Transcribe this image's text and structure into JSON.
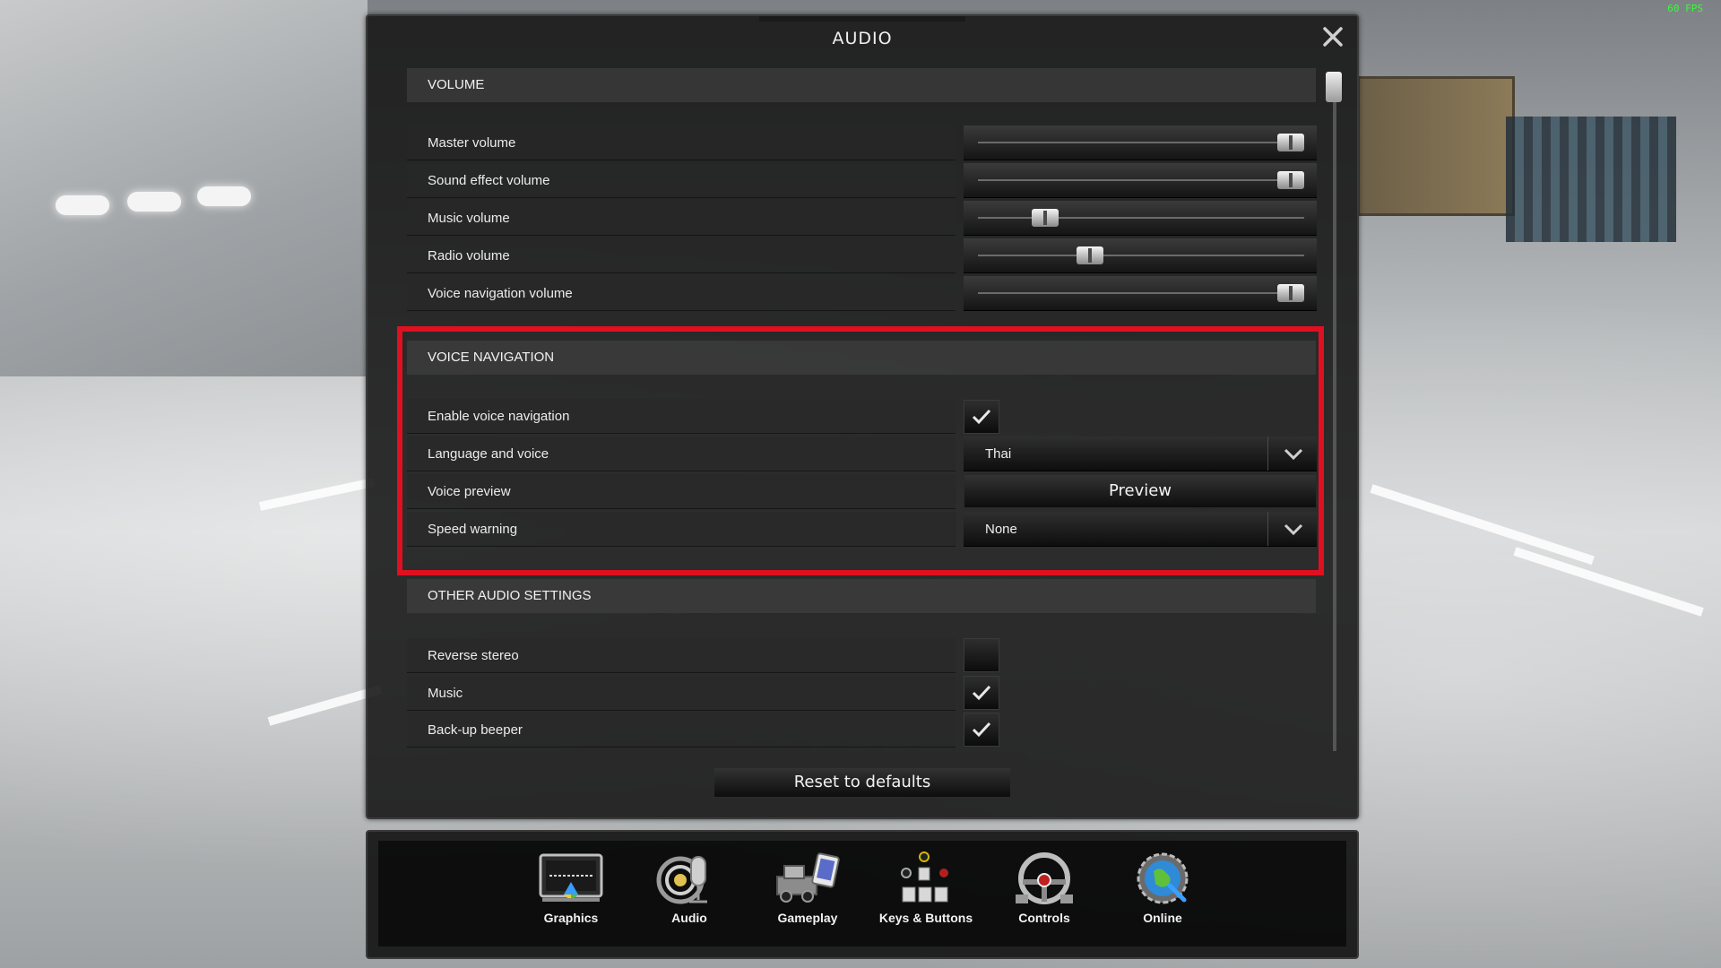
{
  "window": {
    "title": "AUDIO",
    "fps": "60 FPS"
  },
  "volume": {
    "header": "VOLUME",
    "rows": [
      {
        "label": "Master volume",
        "value": 1.0
      },
      {
        "label": "Sound effect volume",
        "value": 1.0
      },
      {
        "label": "Music volume",
        "value": 0.18
      },
      {
        "label": "Radio volume",
        "value": 0.33
      },
      {
        "label": "Voice navigation volume",
        "value": 1.0
      }
    ]
  },
  "voice_navigation": {
    "header": "VOICE NAVIGATION",
    "enable_label": "Enable voice navigation",
    "enable_checked": true,
    "language_label": "Language and voice",
    "language_value": "Thai",
    "preview_label": "Voice preview",
    "preview_button": "Preview",
    "speed_label": "Speed warning",
    "speed_value": "None"
  },
  "other_audio": {
    "header": "OTHER AUDIO SETTINGS",
    "rows": [
      {
        "label": "Reverse stereo",
        "checked": false
      },
      {
        "label": "Music",
        "checked": true
      },
      {
        "label": "Back-up beeper",
        "checked": true
      }
    ]
  },
  "reset_button": "Reset to defaults",
  "highlight_color": "#e01020",
  "dock": [
    {
      "label": "Graphics",
      "icon": "monitor-icon"
    },
    {
      "label": "Audio",
      "icon": "speaker-microphone-icon"
    },
    {
      "label": "Gameplay",
      "icon": "truck-tablet-icon"
    },
    {
      "label": "Keys & Buttons",
      "icon": "keyboard-gamepad-icon"
    },
    {
      "label": "Controls",
      "icon": "steering-wheel-icon"
    },
    {
      "label": "Online",
      "icon": "globe-gear-icon"
    }
  ]
}
